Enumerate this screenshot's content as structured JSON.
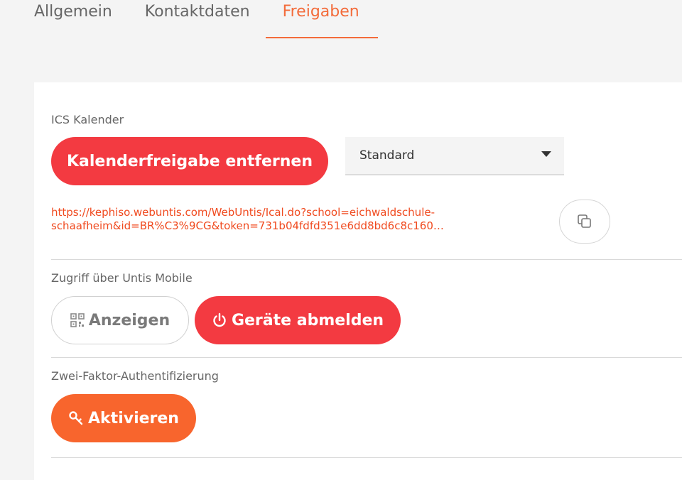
{
  "tabs": [
    {
      "label": "Allgemein",
      "active": false
    },
    {
      "label": "Kontaktdaten",
      "active": false
    },
    {
      "label": "Freigaben",
      "active": true
    }
  ],
  "ics": {
    "label": "ICS Kalender",
    "remove_button": "Kalenderfreigabe entfernen",
    "select_value": "Standard",
    "url_line1": "https://kephiso.webuntis.com/WebUntis/Ical.do?school=eichwaldschule-",
    "url_line2": "schaafheim&id=BR%C3%9CG&token=731b04fdfd351e6dd8bd6c8c160…",
    "copy_icon": "copy-icon"
  },
  "mobile": {
    "label": "Zugriff über Untis Mobile",
    "show_button": "Anzeigen",
    "show_icon": "qr-code-icon",
    "logout_button": "Geräte abmelden",
    "logout_icon": "power-icon"
  },
  "twofa": {
    "label": "Zwei-Faktor-Authentifizierung",
    "activate_button": "Aktivieren",
    "activate_icon": "key-icon"
  },
  "colors": {
    "accent": "#f36b3a",
    "danger": "#f33a41",
    "orange": "#f8652d"
  }
}
